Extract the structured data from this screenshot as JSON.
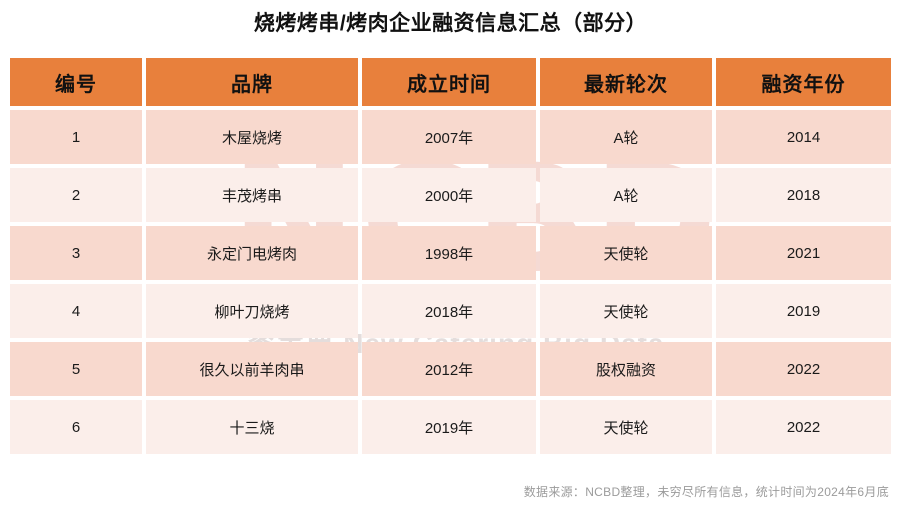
{
  "page_title": "烧烤烤串/烤肉企业融资信息汇总（部分）",
  "watermark": {
    "main": "NCBD",
    "sub": "餐宝典 New Catering Big Data",
    "main_color": "#e8a496",
    "sub_color": "#b9a8a4"
  },
  "colors": {
    "header_bg": "#e8803c",
    "row_odd_bg": "#f8d9ce",
    "row_even_bg": "#fbeeea",
    "page_bg": "#ffffff",
    "text": "#1a1a1a",
    "footnote": "#9b9b9b"
  },
  "table": {
    "columns": [
      "编号",
      "品牌",
      "成立时间",
      "最新轮次",
      "融资年份"
    ],
    "rows": [
      {
        "no": "1",
        "brand": "木屋烧烤",
        "founded": "2007年",
        "round": "A轮",
        "year": "2014"
      },
      {
        "no": "2",
        "brand": "丰茂烤串",
        "founded": "2000年",
        "round": "A轮",
        "year": "2018"
      },
      {
        "no": "3",
        "brand": "永定门电烤肉",
        "founded": "1998年",
        "round": "天使轮",
        "year": "2021"
      },
      {
        "no": "4",
        "brand": "柳叶刀烧烤",
        "founded": "2018年",
        "round": "天使轮",
        "year": "2019"
      },
      {
        "no": "5",
        "brand": "很久以前羊肉串",
        "founded": "2012年",
        "round": "股权融资",
        "year": "2022"
      },
      {
        "no": "6",
        "brand": "十三烧",
        "founded": "2019年",
        "round": "天使轮",
        "year": "2022"
      }
    ]
  },
  "footnote": "数据来源：NCBD整理，未穷尽所有信息，统计时间为2024年6月底"
}
